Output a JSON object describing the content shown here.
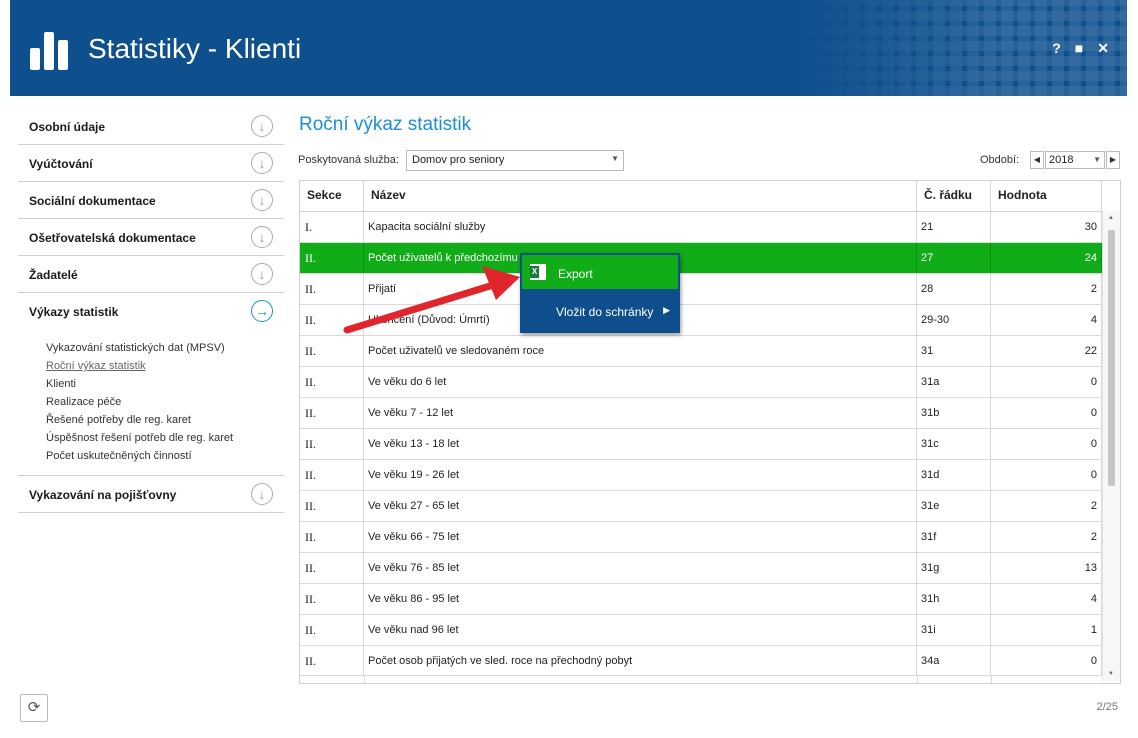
{
  "app": {
    "title": "Statistiky - Klienti",
    "help_label": "?",
    "maximize_label": "■",
    "close_label": "✕"
  },
  "sidebar": {
    "sections": [
      {
        "label": "Osobní údaje"
      },
      {
        "label": "Vyúčtování"
      },
      {
        "label": "Sociální dokumentace"
      },
      {
        "label": "Ošetřovatelská dokumentace"
      },
      {
        "label": "Žadatelé"
      },
      {
        "label": "Výkazy statistik"
      },
      {
        "label": "Vykazování na pojišťovny"
      }
    ],
    "sub_items": [
      {
        "label": "Vykazování statistických dat (MPSV)"
      },
      {
        "label": "Roční výkaz statistik"
      },
      {
        "label": "Klienti"
      },
      {
        "label": "Realizace péče"
      },
      {
        "label": "Řešené potřeby dle reg. karet"
      },
      {
        "label": "Úspěšnost řešení potřeb dle reg. karet"
      },
      {
        "label": "Počet uskutečněných činností"
      }
    ]
  },
  "main": {
    "title": "Roční výkaz statistik",
    "service_label": "Poskytovaná služba:",
    "service_value": "Domov pro seniory",
    "period_label": "Období:",
    "period_value": "2018"
  },
  "table": {
    "columns": [
      "Sekce",
      "Název",
      "Č. řádku",
      "Hodnota"
    ],
    "rows": [
      {
        "sekce": "I.",
        "nazev": "Kapacita sociální služby",
        "radek": "21",
        "hodnota": "30"
      },
      {
        "sekce": "II.",
        "nazev": "Počet uživatelů k předchozímu roku",
        "radek": "27",
        "hodnota": "24"
      },
      {
        "sekce": "II.",
        "nazev": "Přijatí",
        "radek": "28",
        "hodnota": "2"
      },
      {
        "sekce": "II.",
        "nazev": "Ukončení (Důvod: Úmrtí)",
        "radek": "29-30",
        "hodnota": "4"
      },
      {
        "sekce": "II.",
        "nazev": "Počet uživatelů ve sledovaném roce",
        "radek": "31",
        "hodnota": "22"
      },
      {
        "sekce": "II.",
        "nazev": "Ve věku do 6 let",
        "radek": "31a",
        "hodnota": "0"
      },
      {
        "sekce": "II.",
        "nazev": "Ve věku 7 - 12 let",
        "radek": "31b",
        "hodnota": "0"
      },
      {
        "sekce": "II.",
        "nazev": "Ve věku 13 - 18 let",
        "radek": "31c",
        "hodnota": "0"
      },
      {
        "sekce": "II.",
        "nazev": "Ve věku 19 - 26 let",
        "radek": "31d",
        "hodnota": "0"
      },
      {
        "sekce": "II.",
        "nazev": "Ve věku 27 - 65 let",
        "radek": "31e",
        "hodnota": "2"
      },
      {
        "sekce": "II.",
        "nazev": "Ve věku 66 - 75 let",
        "radek": "31f",
        "hodnota": "2"
      },
      {
        "sekce": "II.",
        "nazev": "Ve věku 76 - 85 let",
        "radek": "31g",
        "hodnota": "13"
      },
      {
        "sekce": "II.",
        "nazev": "Ve věku 86 - 95 let",
        "radek": "31h",
        "hodnota": "4"
      },
      {
        "sekce": "II.",
        "nazev": "Ve věku nad 96 let",
        "radek": "31i",
        "hodnota": "1"
      },
      {
        "sekce": "II.",
        "nazev": "Počet osob přijatých ve sled. roce na přechodný pobyt",
        "radek": "34a",
        "hodnota": "0"
      }
    ]
  },
  "context_menu": {
    "export_label": "Export",
    "clipboard_label": "Vložit do schránky",
    "excel_glyph": "X",
    "submenu_glyph": "▶"
  },
  "footer": {
    "pager": "2/25",
    "refresh_glyph": "⟳"
  },
  "colors": {
    "header": "#0e4f8e",
    "accent": "#1c8fd0",
    "selection": "#11ad18",
    "arrow": "#e0262c"
  }
}
